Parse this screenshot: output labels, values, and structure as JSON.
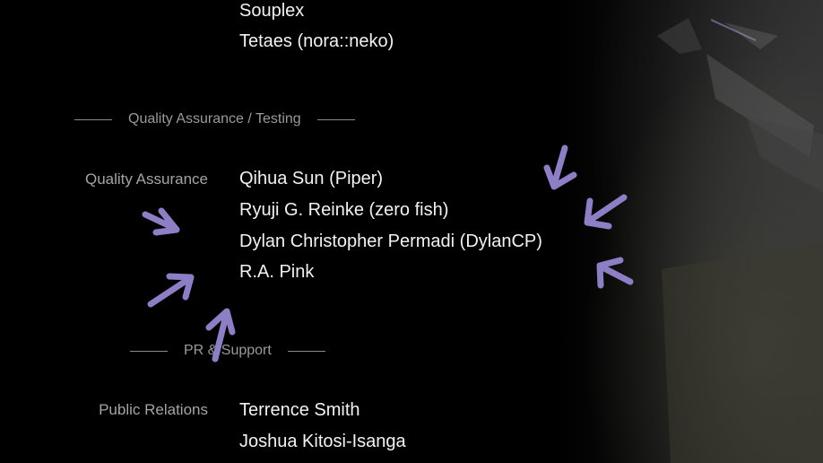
{
  "top_names": [
    "Souplex",
    "Tetaes (nora::neko)"
  ],
  "sections": [
    {
      "header": "Quality Assurance / Testing",
      "role": "Quality Assurance",
      "names": [
        "Qihua Sun (Piper)",
        "Ryuji G. Reinke (zero fish)",
        "Dylan Christopher Permadi (DylanCP)",
        "R.A. Pink"
      ]
    },
    {
      "header": "PR & Support",
      "role": "Public Relations",
      "names": [
        "Terrence Smith",
        "Joshua Kitosi-Isanga"
      ]
    }
  ],
  "colors": {
    "background": "#000000",
    "name_text": "#f2f2f2",
    "label_text": "#a4a4a4",
    "arrow": "#8e7ec6"
  }
}
